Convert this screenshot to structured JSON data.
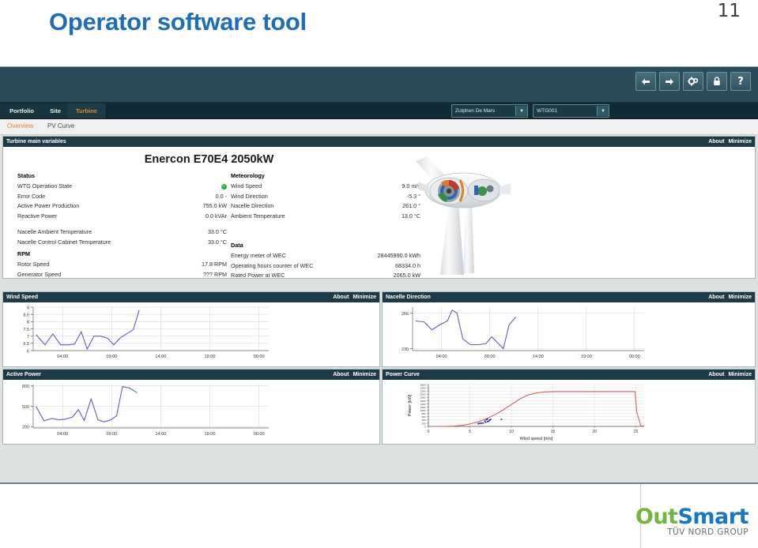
{
  "slide": {
    "title": "Operator software tool",
    "page_number": "11",
    "title_color": "#1f6eb5"
  },
  "app": {
    "toolbar": [
      {
        "name": "back-icon",
        "glyph": "◀"
      },
      {
        "name": "forward-icon",
        "glyph": "▶"
      },
      {
        "name": "settings-icon",
        "glyph": "⚙"
      },
      {
        "name": "lock-icon",
        "glyph": "■"
      },
      {
        "name": "help-icon",
        "glyph": "?"
      }
    ],
    "tabs": [
      {
        "label": "Portfolio",
        "active": false
      },
      {
        "label": "Site",
        "active": false
      },
      {
        "label": "Turbine",
        "active": true
      }
    ],
    "subtabs": [
      {
        "label": "Overview",
        "active": true
      },
      {
        "label": "PV Curve",
        "active": false
      }
    ],
    "dropdowns": {
      "site": {
        "value": "Zutphen De Mars",
        "arrow": "▼"
      },
      "turbine": {
        "value": "WTG001",
        "arrow": "▼"
      }
    },
    "accent_active": "#e8822a",
    "header_color": "#1d3b46"
  },
  "panels": {
    "main": {
      "title": "Turbine main variables",
      "about": "About",
      "minimize": "Minimize",
      "model_title": "Enercon E70E4 2050kW",
      "groups": {
        "status": {
          "heading": "Status",
          "rows": [
            {
              "label": "WTG Operation State",
              "value": "",
              "indicator": "status-dot-green"
            },
            {
              "label": "Error Code",
              "value": "0.0 -"
            },
            {
              "label": "Active Power Production",
              "value": "755.0 kW"
            },
            {
              "label": "Reactive Power",
              "value": "0.0 kVAr"
            }
          ]
        },
        "temperatures": {
          "rows": [
            {
              "label": "Nacelle Ambient Temperature",
              "value": "33.0 °C"
            },
            {
              "label": "Nacelle Control Cabinet Temperature",
              "value": "33.0 °C"
            }
          ]
        },
        "rpm": {
          "heading": "RPM",
          "rows": [
            {
              "label": "Rotor Speed",
              "value": "17.8 RPM"
            },
            {
              "label": "Generator Speed",
              "value": "??? RPM"
            }
          ]
        },
        "meteorology": {
          "heading": "Meteorology",
          "rows": [
            {
              "label": "Wind Speed",
              "value": "9.0 m/s"
            },
            {
              "label": "Wind Direction",
              "value": "-5.3 °"
            },
            {
              "label": "Nacelle Direction",
              "value": "261.0 °"
            },
            {
              "label": "Ambient Temperature",
              "value": "13.0 °C"
            }
          ]
        },
        "data": {
          "heading": "Data",
          "rows": [
            {
              "label": "Energy meter of WEC",
              "value": "28445990.0 kWh"
            },
            {
              "label": "Operating hours counter of WEC",
              "value": "68334.0 h"
            },
            {
              "label": "Rated Power at WEC",
              "value": "2065.0 kW"
            }
          ]
        }
      }
    },
    "wind_speed": {
      "title": "Wind Speed",
      "about": "About",
      "minimize": "Minimize"
    },
    "nacelle_direction": {
      "title": "Nacelle Direction",
      "about": "About",
      "minimize": "Minimize"
    },
    "active_power": {
      "title": "Active Power",
      "about": "About",
      "minimize": "Minimize"
    },
    "power_curve": {
      "title": "Power Curve",
      "about": "About",
      "minimize": "Minimize"
    }
  },
  "footer": {
    "logo_out": "Out",
    "logo_smart": "Smart",
    "logo_sub": "TÜV NORD GROUP",
    "logo_out_color": "#72b543",
    "logo_smart_color": "#1878c0"
  },
  "chart_data": [
    {
      "id": "wind_speed",
      "type": "line",
      "title": "Wind Speed",
      "xlabel": "",
      "ylabel": "",
      "line_color": "#5b5fd0",
      "grid": true,
      "ylim": [
        6,
        9
      ],
      "yticks": [
        6,
        6.5,
        7,
        7.5,
        8,
        8.5,
        9
      ],
      "ytick_labels": [
        "6",
        "6.5",
        "7",
        "7.5",
        "8",
        "8.5",
        "9"
      ],
      "xticks": [
        4,
        9,
        14,
        19,
        24
      ],
      "xtick_labels": [
        "04:00",
        "09:00",
        "14:00",
        "19:00",
        "00:00"
      ],
      "xlim": [
        1,
        25
      ],
      "x": [
        1.3,
        2.2,
        3.0,
        3.8,
        4.6,
        5.2,
        5.9,
        6.5,
        7.2,
        7.9,
        8.6,
        9.2,
        9.9,
        10.5,
        11.2,
        11.8
      ],
      "values": [
        7.1,
        6.4,
        7.15,
        6.4,
        6.4,
        6.45,
        7.3,
        6.1,
        7.0,
        7.0,
        6.85,
        6.4,
        6.9,
        7.15,
        7.45,
        8.8
      ]
    },
    {
      "id": "nacelle_direction",
      "type": "line",
      "title": "Nacelle Direction",
      "xlabel": "",
      "ylabel": "",
      "line_color": "#5b5fd0",
      "grid": true,
      "ylim": [
        228,
        272
      ],
      "yticks": [
        230,
        266
      ],
      "ytick_labels": [
        "230",
        "266"
      ],
      "xticks": [
        4,
        9,
        14,
        19,
        24
      ],
      "xtick_labels": [
        "04:00",
        "09:00",
        "14:00",
        "19:00",
        "00:00"
      ],
      "xlim": [
        1,
        25
      ],
      "x": [
        1.3,
        2.2,
        3.0,
        3.8,
        4.6,
        5.1,
        5.6,
        6.2,
        7.0,
        7.8,
        8.6,
        9.2,
        9.8,
        10.4,
        11.0,
        11.7
      ],
      "values": [
        258,
        257,
        249,
        254,
        258,
        269,
        266,
        240,
        234,
        234,
        235,
        242,
        236,
        230,
        254,
        262
      ]
    },
    {
      "id": "active_power",
      "type": "line",
      "title": "Active Power",
      "xlabel": "",
      "ylabel": "",
      "line_color": "#5b5fd0",
      "grid": true,
      "ylim": [
        180,
        820
      ],
      "yticks": [
        200,
        500,
        800
      ],
      "ytick_labels": [
        "200",
        "500",
        "800"
      ],
      "xticks": [
        4,
        9,
        14,
        19,
        24
      ],
      "xtick_labels": [
        "04:00",
        "09:00",
        "14:00",
        "19:00",
        "00:00"
      ],
      "xlim": [
        1,
        25
      ],
      "x": [
        1.3,
        2.1,
        2.9,
        3.6,
        4.3,
        5.0,
        5.6,
        6.2,
        6.9,
        7.6,
        8.2,
        8.9,
        9.5,
        10.1,
        10.8,
        11.6
      ],
      "values": [
        495,
        285,
        320,
        300,
        310,
        340,
        450,
        290,
        610,
        300,
        270,
        300,
        360,
        790,
        770,
        700
      ]
    },
    {
      "id": "power_curve",
      "type": "line",
      "title": "Power Curve",
      "xlabel": "Wind speed [m/s]",
      "ylabel": "Power [kW]",
      "line_color": "#d4564f",
      "scatter_color": "#2b2f8f",
      "grid": true,
      "xlim": [
        0,
        26
      ],
      "ylim": [
        0,
        2600
      ],
      "xticks": [
        0,
        5,
        10,
        15,
        20,
        25
      ],
      "xtick_labels": [
        "0",
        "5",
        "10",
        "15",
        "20",
        "25"
      ],
      "yticks": [
        0,
        200,
        400,
        600,
        800,
        1000,
        1200,
        1400,
        1600,
        1800,
        2000,
        2200,
        2400,
        2600
      ],
      "ytick_labels": [
        "0",
        "200",
        "400",
        "600",
        "800",
        "1000",
        "1200",
        "1400",
        "1600",
        "1800",
        "2000",
        "2200",
        "2400",
        "2600"
      ],
      "curve_x": [
        1,
        2,
        3,
        4,
        5,
        6,
        7,
        8,
        9,
        10,
        11,
        12,
        13,
        14,
        15,
        20,
        24.9,
        25.1,
        25.6,
        26
      ],
      "curve_y": [
        0,
        2,
        18,
        60,
        145,
        290,
        480,
        720,
        1020,
        1360,
        1700,
        1950,
        2080,
        2140,
        2160,
        2160,
        2160,
        900,
        30,
        20
      ],
      "scatter_x": [
        6.0,
        6.2,
        6.4,
        6.6,
        6.8,
        6.9,
        7.0,
        7.1,
        7.15,
        7.3,
        7.4,
        7.5,
        8.8
      ],
      "scatter_y": [
        170,
        190,
        200,
        210,
        330,
        260,
        420,
        450,
        300,
        350,
        400,
        430,
        430
      ]
    }
  ]
}
